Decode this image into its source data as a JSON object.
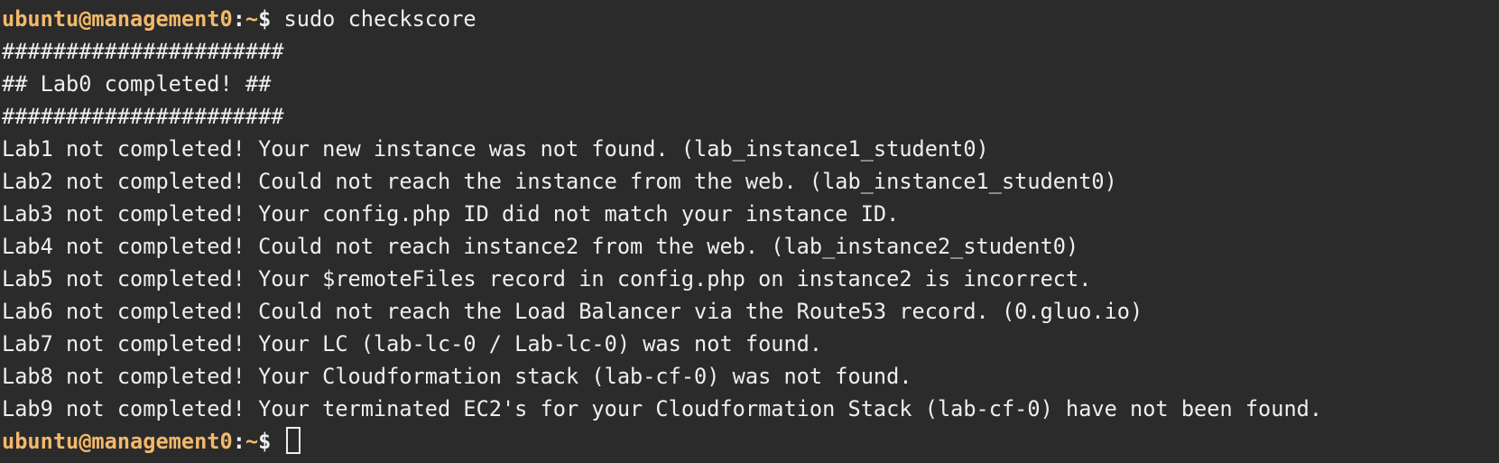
{
  "terminal": {
    "prompt": {
      "user_host": "ubuntu@management0",
      "separator": ":",
      "path": "~",
      "symbol": "$"
    },
    "command": " sudo checkscore",
    "output": [
      "######################",
      "## Lab0 completed! ##",
      "######################",
      "Lab1 not completed! Your new instance was not found. (lab_instance1_student0)",
      "Lab2 not completed! Could not reach the instance from the web. (lab_instance1_student0)",
      "Lab3 not completed! Your config.php ID did not match your instance ID.",
      "Lab4 not completed! Could not reach instance2 from the web. (lab_instance2_student0)",
      "Lab5 not completed! Your $remoteFiles record in config.php on instance2 is incorrect.",
      "Lab6 not completed! Could not reach the Load Balancer via the Route53 record. (0.gluo.io)",
      "Lab7 not completed! Your LC (lab-lc-0 / Lab-lc-0) was not found.",
      "Lab8 not completed! Your Cloudformation stack (lab-cf-0) was not found.",
      "Lab9 not completed! Your terminated EC2's for your Cloudformation Stack (lab-cf-0) have not been found."
    ],
    "colors": {
      "background": "#2b2b2b",
      "text": "#efefef",
      "prompt": "#f2b96a"
    }
  }
}
